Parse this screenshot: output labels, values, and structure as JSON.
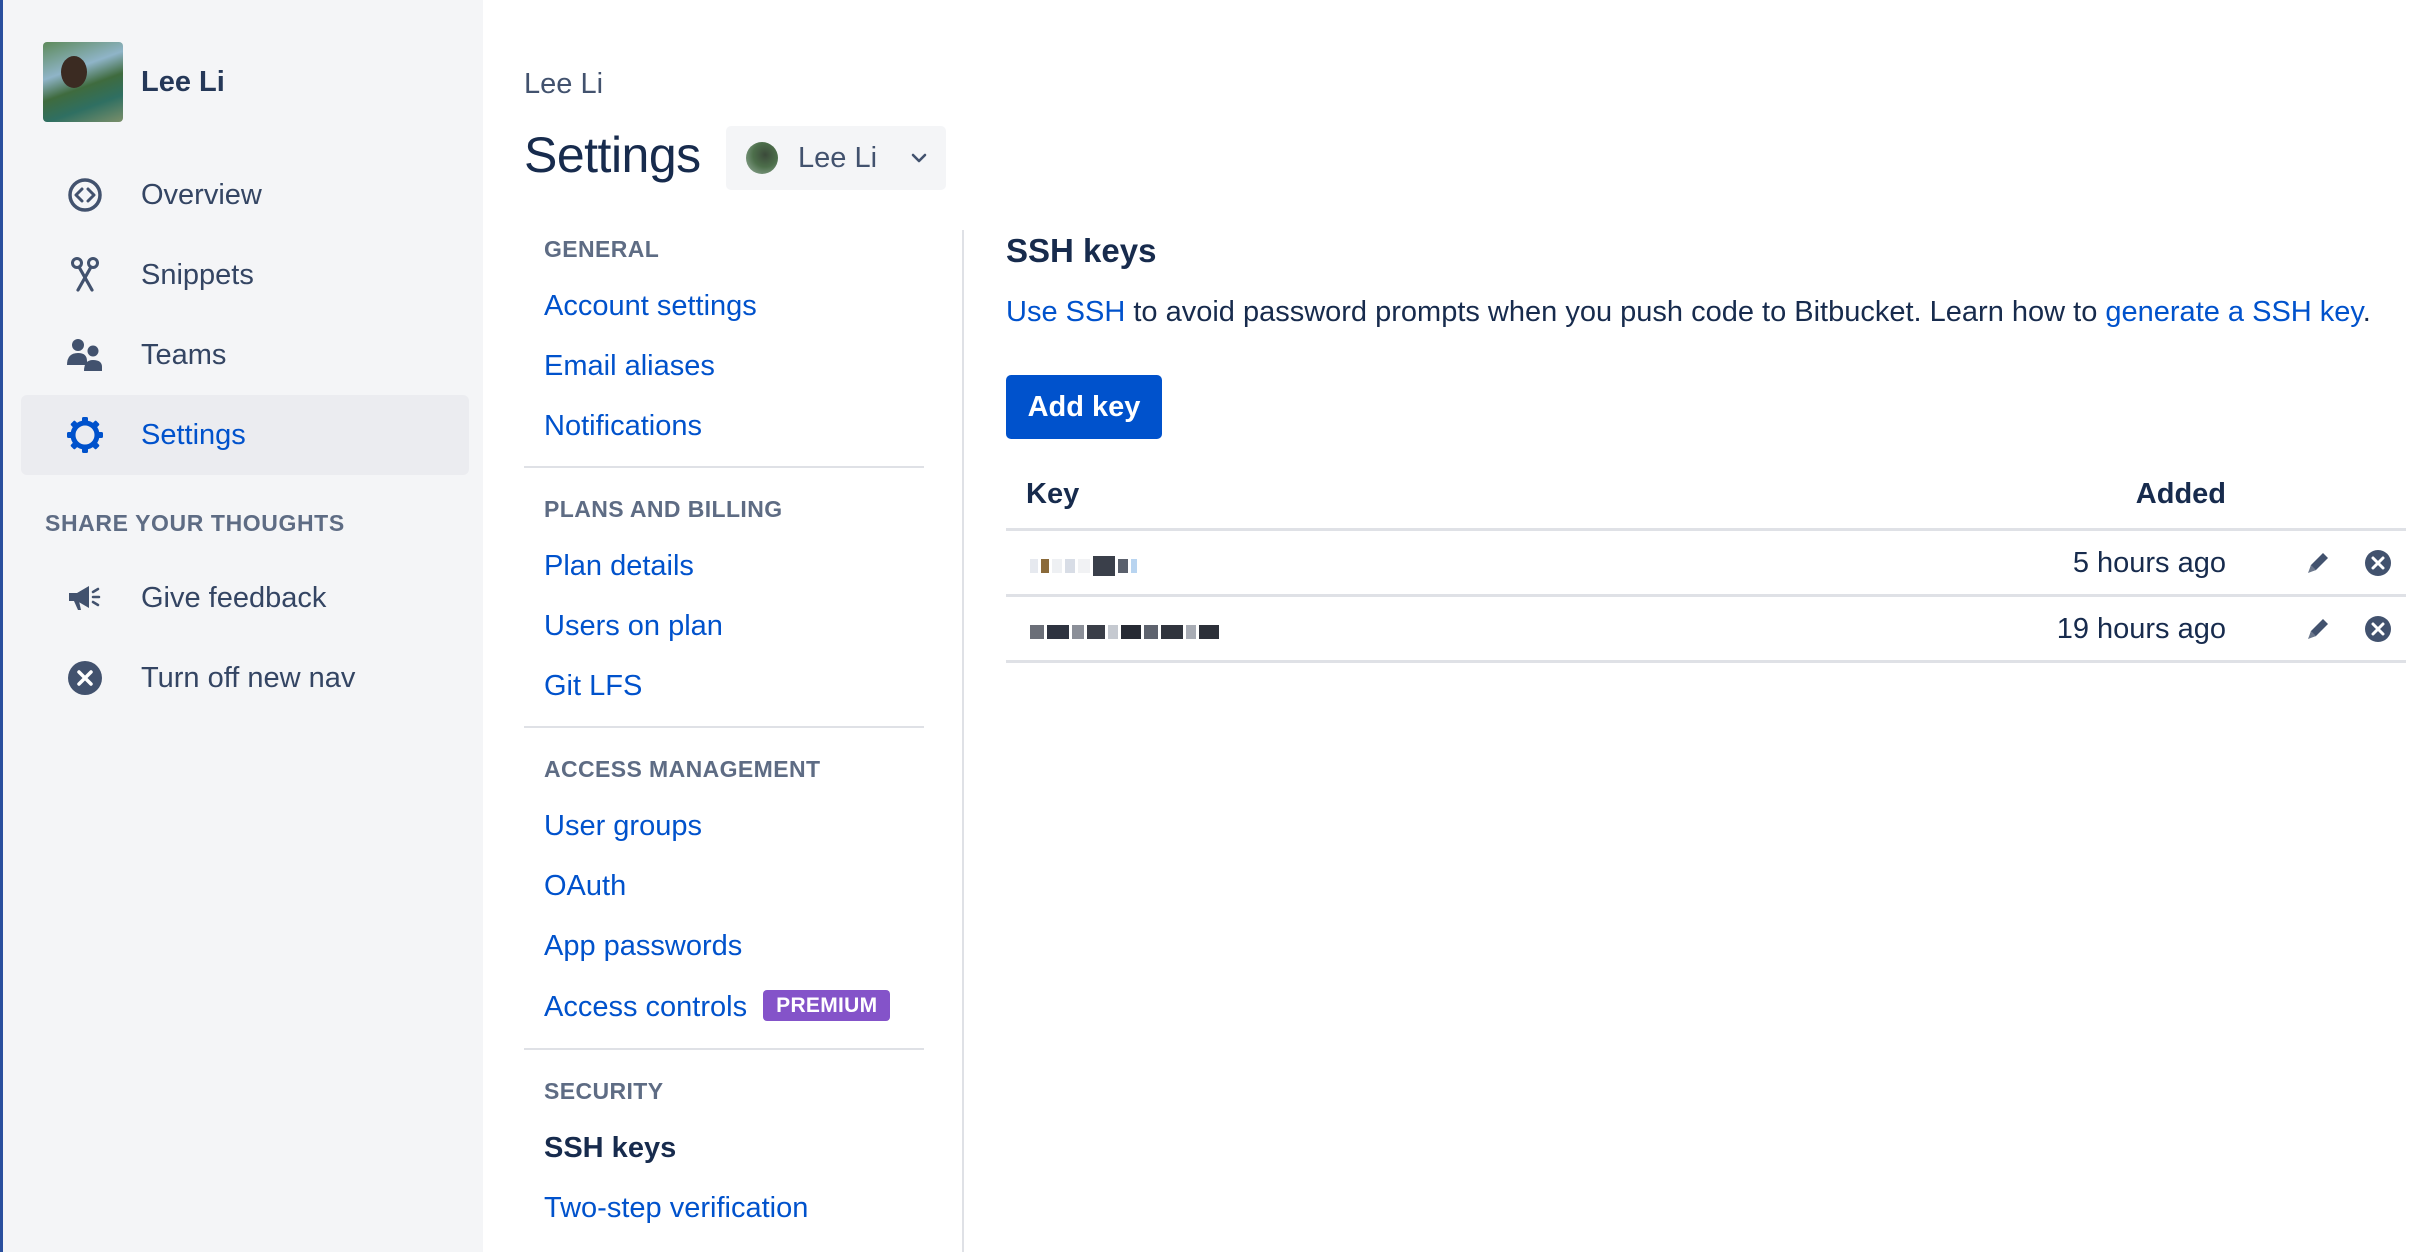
{
  "user": {
    "name": "Lee Li"
  },
  "nav": {
    "items": [
      {
        "label": "Overview",
        "icon": "overview-icon"
      },
      {
        "label": "Snippets",
        "icon": "snippets-icon"
      },
      {
        "label": "Teams",
        "icon": "teams-icon"
      },
      {
        "label": "Settings",
        "icon": "gear-icon",
        "active": true
      }
    ],
    "feedback_heading": "SHARE YOUR THOUGHTS",
    "feedback_items": [
      {
        "label": "Give feedback",
        "icon": "megaphone-icon"
      },
      {
        "label": "Turn off new nav",
        "icon": "close-circle-icon"
      }
    ]
  },
  "header": {
    "breadcrumb": "Lee Li",
    "title": "Settings",
    "account_switcher_label": "Lee Li"
  },
  "settings_nav": {
    "sections": [
      {
        "heading": "GENERAL",
        "links": [
          "Account settings",
          "Email aliases",
          "Notifications"
        ]
      },
      {
        "heading": "PLANS AND BILLING",
        "links": [
          "Plan details",
          "Users on plan",
          "Git LFS"
        ]
      },
      {
        "heading": "ACCESS MANAGEMENT",
        "links": [
          "User groups",
          "OAuth",
          "App passwords",
          "Access controls"
        ]
      },
      {
        "heading": "SECURITY",
        "links": [
          "SSH keys",
          "Two-step verification"
        ]
      }
    ],
    "premium_badge": "PREMIUM",
    "current": "SSH keys"
  },
  "content": {
    "title": "SSH keys",
    "desc_link1": "Use SSH",
    "desc_text": " to avoid password prompts when you push code to Bitbucket. Learn how to ",
    "desc_link2": "generate a SSH key",
    "desc_end": ".",
    "add_button": "Add key",
    "table": {
      "headers": {
        "key": "Key",
        "added": "Added"
      },
      "rows": [
        {
          "added": "5 hours ago"
        },
        {
          "added": "19 hours ago"
        }
      ]
    }
  },
  "colors": {
    "link": "#0052cc",
    "primary_button": "#0052cc",
    "premium_badge": "#8453c9",
    "sidebar_bg": "#f4f5f7",
    "text": "#172b4d"
  }
}
